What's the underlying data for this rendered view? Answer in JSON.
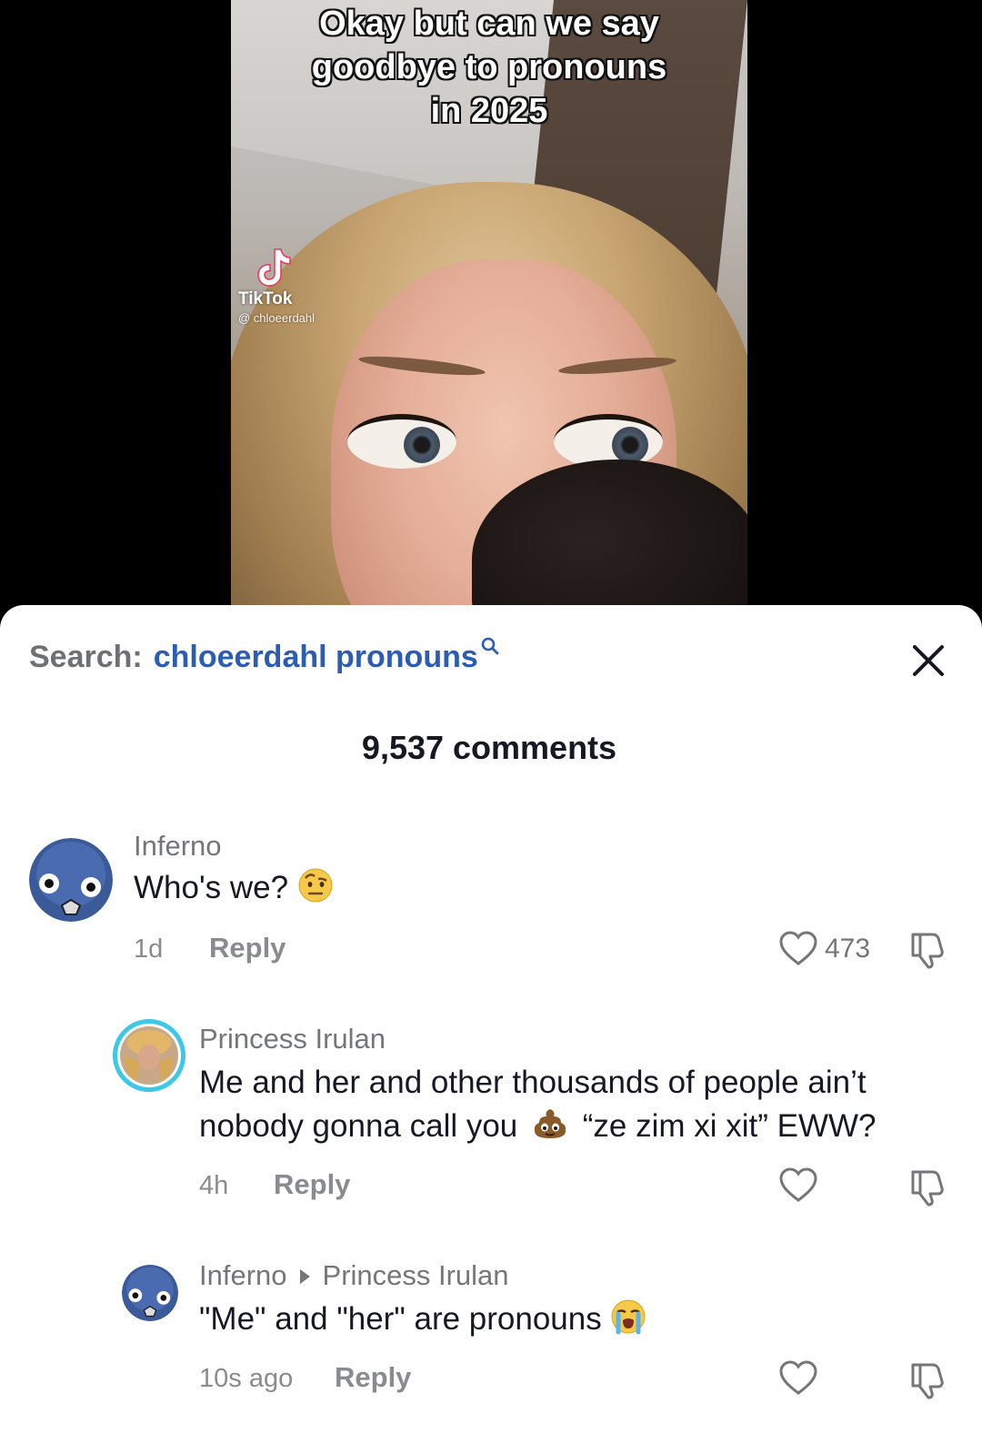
{
  "video": {
    "caption_lines": [
      "Okay but can we say",
      "goodbye to pronouns",
      "in 2025"
    ],
    "watermark": {
      "app": "TikTok",
      "handle": "@ chloeerdahl"
    }
  },
  "search": {
    "label": "Search:",
    "query": "chloeerdahl pronouns"
  },
  "comment_count": "9,537 comments",
  "comments": [
    {
      "user": "Inferno",
      "text": "Who's we?",
      "emoji": "face-with-raised-eyebrow",
      "time": "1d",
      "reply_label": "Reply",
      "likes": "473"
    },
    {
      "user": "Princess Irulan",
      "text_line1": "Me and her and other thousands of people ain’t",
      "text_line2_a": "nobody gonna call you",
      "emoji": "pile-of-poo",
      "text_line2_b": "“ze zim xi xit” EWW?",
      "time": "4h",
      "reply_label": "Reply",
      "likes": ""
    },
    {
      "user": "Inferno",
      "reply_to": "Princess Irulan",
      "text": "\"Me\" and \"her\" are pronouns",
      "emoji": "loudly-crying-face",
      "time": "10s ago",
      "reply_label": "Reply",
      "likes": ""
    }
  ],
  "colors": {
    "link_blue": "#2b5db4",
    "text_dark": "#161823",
    "text_gray": "#75767b",
    "avatar_ring": "#3ec8e8",
    "avatar_blue": "#3a5a9a"
  },
  "icons": [
    "tiktok-logo-icon",
    "search-icon",
    "close-icon",
    "heart-icon",
    "dislike-icon",
    "avatar-icon"
  ]
}
